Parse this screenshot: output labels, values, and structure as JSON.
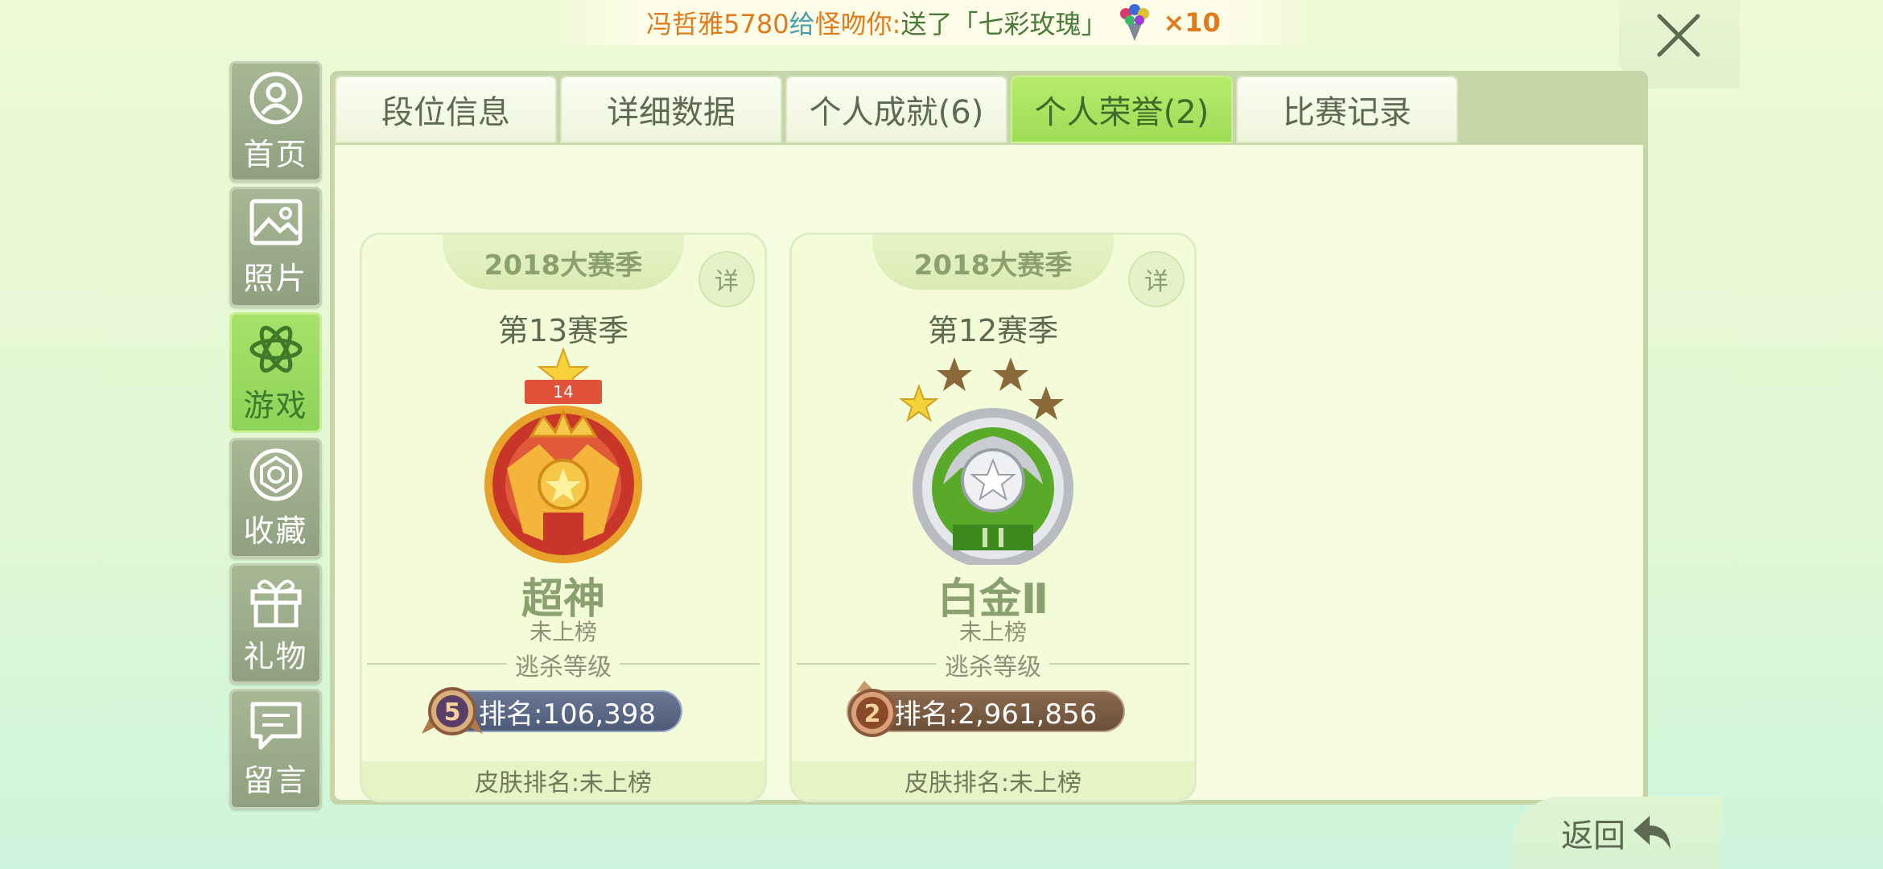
{
  "banner": {
    "sender": "冯哲雅5780",
    "connector": "给",
    "recipient": "怪吻你:",
    "action": "送了",
    "gift_name": "「七彩玫瑰」",
    "count": "×10"
  },
  "sidebar": {
    "items": [
      {
        "label": "首页",
        "icon": "user-icon"
      },
      {
        "label": "照片",
        "icon": "photo-icon"
      },
      {
        "label": "游戏",
        "icon": "atom-icon",
        "active": true
      },
      {
        "label": "收藏",
        "icon": "gem-icon"
      },
      {
        "label": "礼物",
        "icon": "gift-icon"
      },
      {
        "label": "留言",
        "icon": "message-icon"
      }
    ]
  },
  "tabs": [
    {
      "label": "段位信息"
    },
    {
      "label": "详细数据"
    },
    {
      "label": "个人成就(6)"
    },
    {
      "label": "个人荣誉(2)",
      "active": true
    },
    {
      "label": "比赛记录"
    }
  ],
  "cards": [
    {
      "season_group": "2018大赛季",
      "detail_label": "详",
      "season": "第13赛季",
      "badge_number": "14",
      "rank_title": "超神",
      "status": "未上榜",
      "section_label": "逃杀等级",
      "level": "5",
      "ranking": "排名:106,398",
      "skin_ranking": "皮肤排名:未上榜"
    },
    {
      "season_group": "2018大赛季",
      "detail_label": "详",
      "season": "第12赛季",
      "badge_number": "II",
      "rank_title": "白金Ⅱ",
      "status": "未上榜",
      "section_label": "逃杀等级",
      "level": "2",
      "ranking": "排名:2,961,856",
      "skin_ranking": "皮肤排名:未上榜"
    }
  ],
  "back": {
    "label": "返回"
  },
  "colors": {
    "accent_green": "#9edc55",
    "text_olive": "#8aa06f",
    "sender_orange": "#e07a1a"
  }
}
